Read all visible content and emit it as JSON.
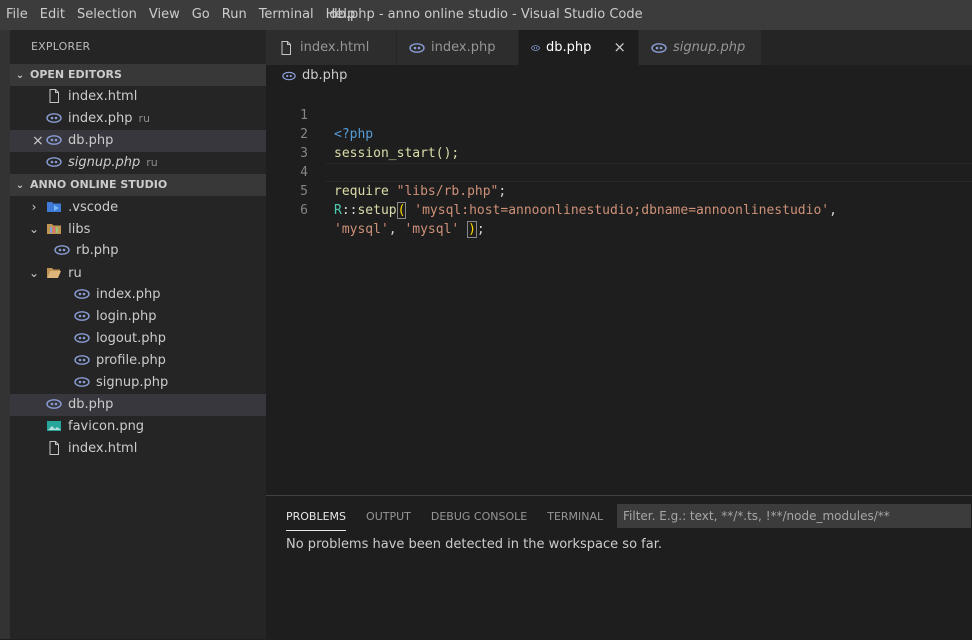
{
  "menu": [
    "File",
    "Edit",
    "Selection",
    "View",
    "Go",
    "Run",
    "Terminal",
    "Help"
  ],
  "window_title": "db.php - anno online studio - Visual Studio Code",
  "explorer": {
    "title": "EXPLORER",
    "open_editors_header": "OPEN EDITORS",
    "open_editors": [
      {
        "name": "index.html",
        "hint": "",
        "icon": "file-icon"
      },
      {
        "name": "index.php",
        "hint": "ru",
        "icon": "php-icon"
      },
      {
        "name": "db.php",
        "hint": "",
        "icon": "php-icon",
        "close": "×"
      },
      {
        "name": "signup.php",
        "hint": "ru",
        "icon": "php-icon"
      }
    ],
    "project_header": "ANNO ONLINE STUDIO",
    "tree": [
      {
        "name": ".vscode",
        "chevron": "›"
      },
      {
        "name": "libs",
        "chevron": "⌄"
      },
      {
        "name": "rb.php"
      },
      {
        "name": "ru",
        "chevron": "⌄"
      },
      {
        "name": "index.php"
      },
      {
        "name": "login.php"
      },
      {
        "name": "logout.php"
      },
      {
        "name": "profile.php"
      },
      {
        "name": "signup.php"
      },
      {
        "name": "db.php"
      },
      {
        "name": "favicon.png"
      },
      {
        "name": "index.html"
      }
    ]
  },
  "tabs": [
    {
      "label": "index.html"
    },
    {
      "label": "index.php"
    },
    {
      "label": "db.php",
      "close": "×"
    },
    {
      "label": "signup.php"
    }
  ],
  "breadcrumb": "db.php",
  "code": {
    "line_numbers": [
      "1",
      "2",
      "3",
      "4",
      "5",
      "6"
    ],
    "l1": "<?php",
    "l2": "session_start();",
    "l4_kw": "require",
    "l4_str": "\"libs/rb.php\"",
    "l4_end": ";",
    "l5_cls": "R",
    "l5_op": "::",
    "l5_fn": "setup",
    "l5_paren": "(",
    "l5_str": "'mysql:host=annoonlinestudio;dbname=annoonlinestudio'",
    "l5_end": ",",
    "l6_s1": "'mysql'",
    "l6_comma": ", ",
    "l6_s2": "'mysql'",
    "l6_paren": ")",
    "l6_end": ";"
  },
  "panel": {
    "tabs": [
      "PROBLEMS",
      "OUTPUT",
      "DEBUG CONSOLE",
      "TERMINAL"
    ],
    "filter_placeholder": "Filter. E.g.: text, **/*.ts, !**/node_modules/**",
    "message": "No problems have been detected in the workspace so far."
  }
}
